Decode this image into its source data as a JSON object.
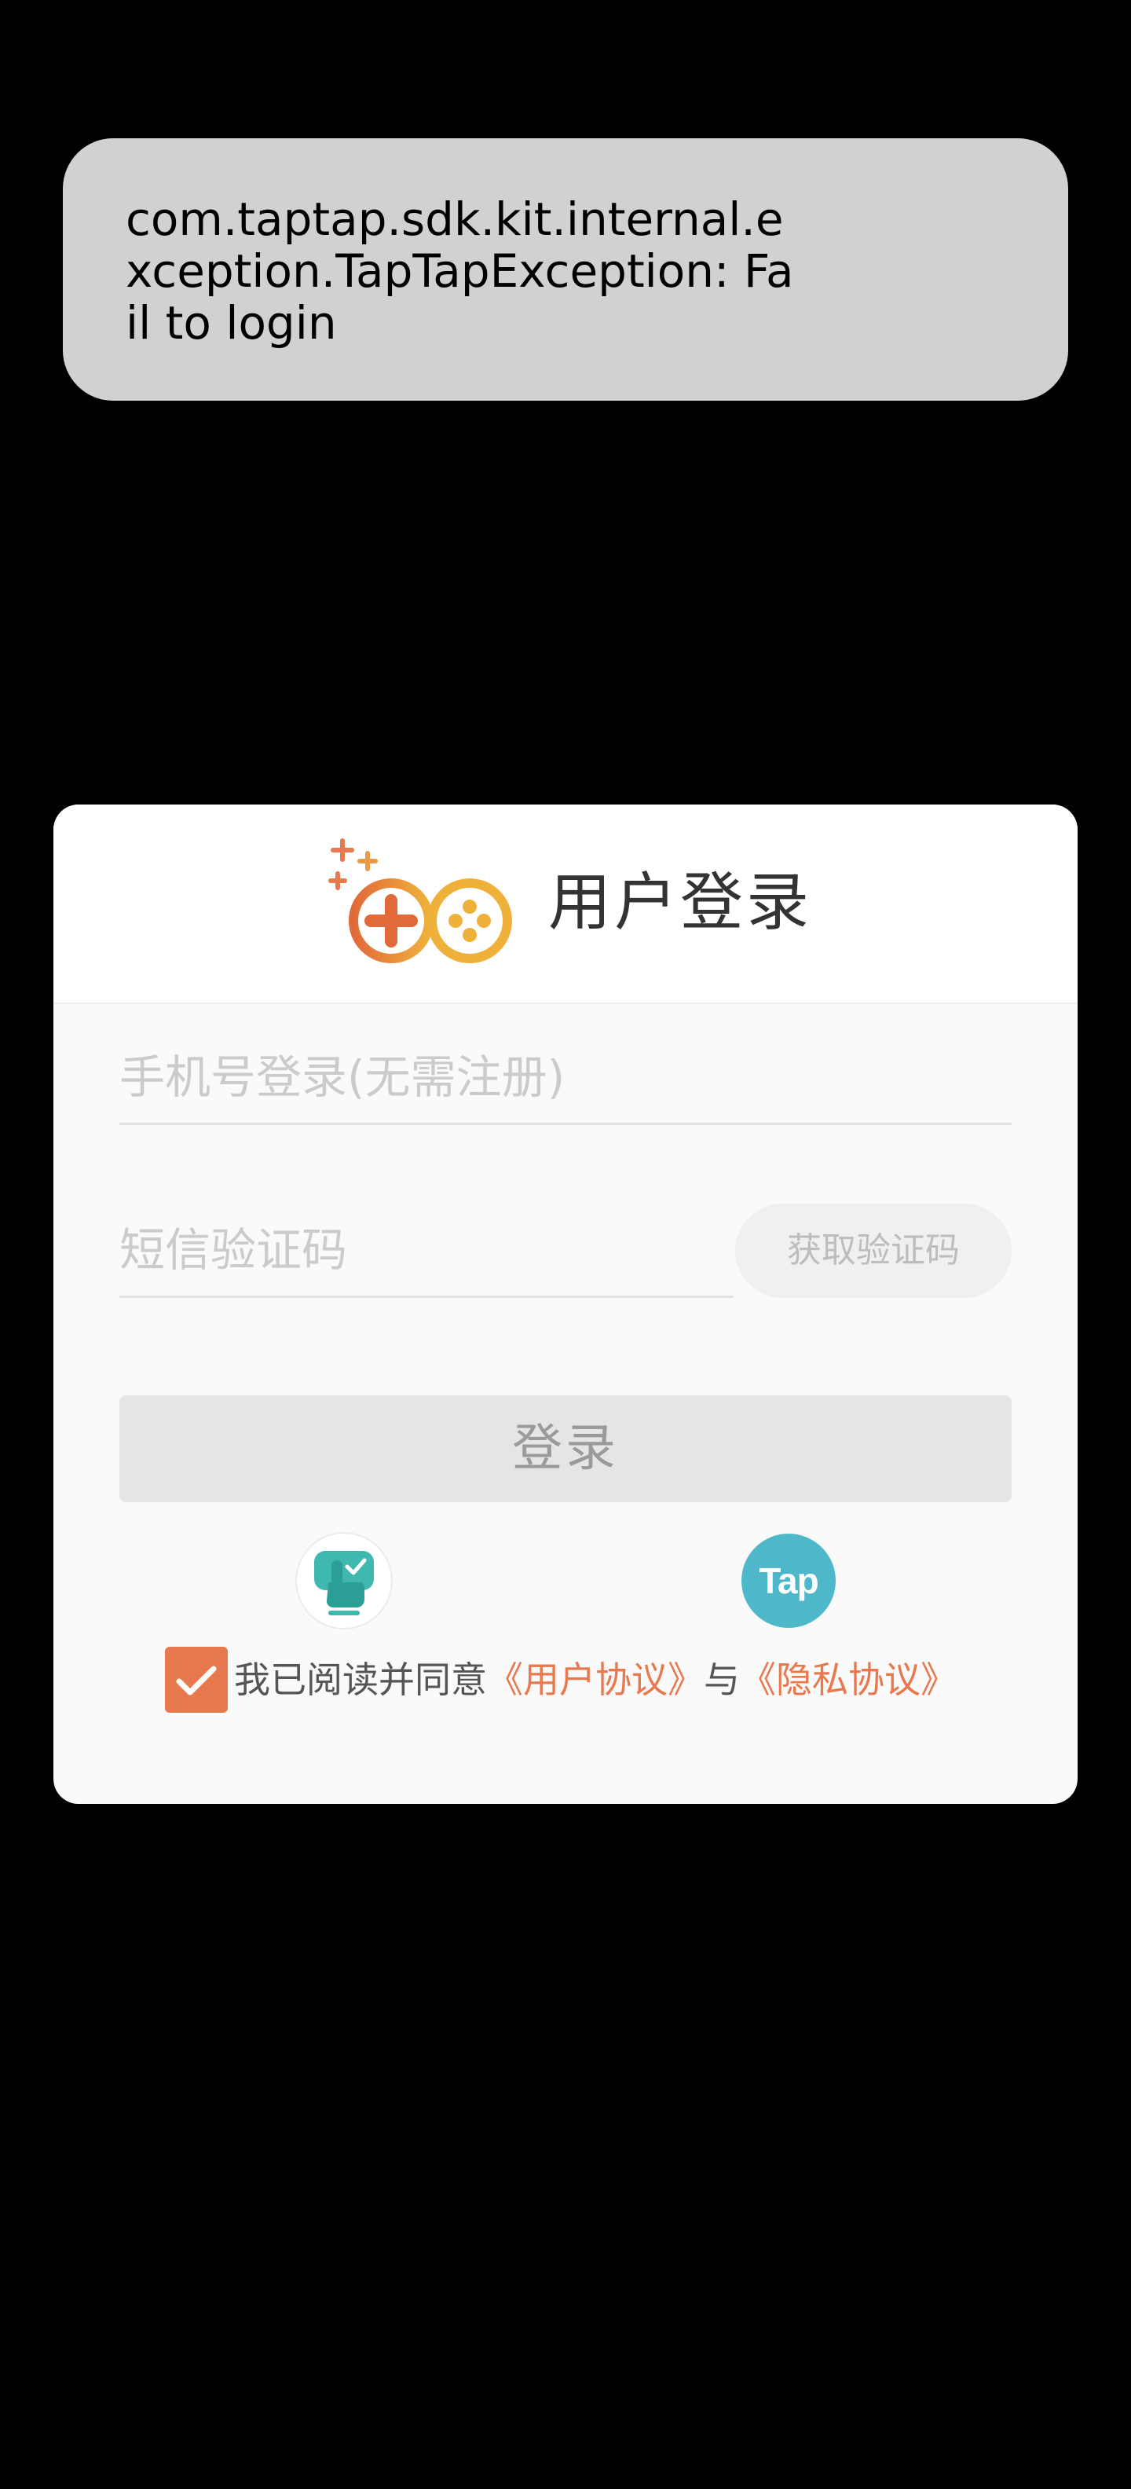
{
  "toast": {
    "message": "com.taptap.sdk.kit.internal.exception.TapTapException: Fail to login"
  },
  "dialog": {
    "title": "用户登录",
    "phone": {
      "placeholder": "手机号登录(无需注册)",
      "value": ""
    },
    "sms_code": {
      "placeholder": "短信验证码",
      "value": ""
    },
    "get_code_label": "获取验证码",
    "login_label": "登录",
    "alt_logins": [
      {
        "icon": "quick-login-hand-icon"
      },
      {
        "icon": "taptap-icon",
        "label": "Tap"
      }
    ],
    "agreement": {
      "checked": true,
      "prefix": "我已阅读并同意",
      "user_agreement": "《用户协议》",
      "separator": "与",
      "privacy_policy": "《隐私协议》"
    }
  },
  "colors": {
    "accent": "#e8794f",
    "tap_brand": "#4db8c9",
    "toast_bg": "#d1d1d1",
    "backdrop": "#000000"
  }
}
